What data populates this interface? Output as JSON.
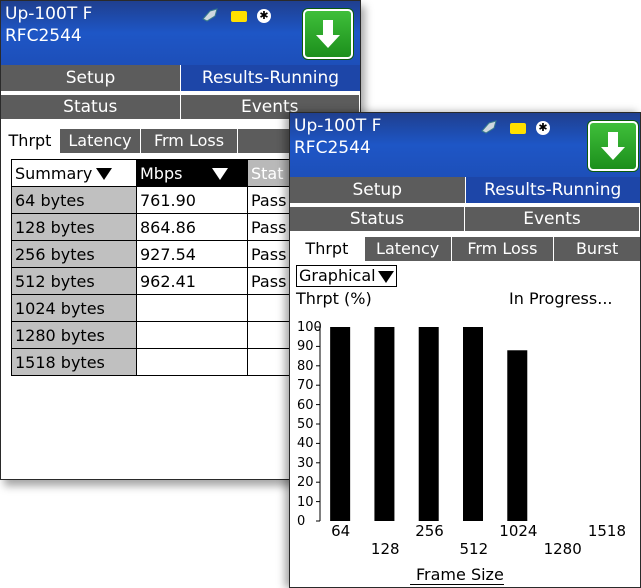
{
  "device": {
    "line1": "Up-100T F",
    "line2": "RFC2544"
  },
  "icons": [
    "usb-icon",
    "folder-icon",
    "bluetooth-icon",
    "download-arrow-icon"
  ],
  "tabs_main": [
    {
      "label": "Setup",
      "active": false
    },
    {
      "label": "Results-Running",
      "active": true
    }
  ],
  "tabs_sub": [
    "Status",
    "Events"
  ],
  "tabs_test": [
    "Thrpt",
    "Latency",
    "Frm Loss",
    "Burst"
  ],
  "summary_panel": {
    "tabs_sub": [
      "Status",
      "Events"
    ],
    "tabs_test": [
      "Thrpt",
      "Latency",
      "Frm Loss"
    ],
    "header": {
      "col1": "Summary",
      "col2": "Mbps",
      "col3": "Stat"
    },
    "rows": [
      {
        "size": "64 bytes",
        "mbps": "761.90",
        "status": "Pass"
      },
      {
        "size": "128 bytes",
        "mbps": "864.86",
        "status": "Pass"
      },
      {
        "size": "256 bytes",
        "mbps": "927.54",
        "status": "Pass"
      },
      {
        "size": "512 bytes",
        "mbps": "962.41",
        "status": "Pass"
      },
      {
        "size": "1024 bytes",
        "mbps": "",
        "status": ""
      },
      {
        "size": "1280 bytes",
        "mbps": "",
        "status": ""
      },
      {
        "size": "1518 bytes",
        "mbps": "",
        "status": ""
      }
    ]
  },
  "graph_panel": {
    "view_select": "Graphical",
    "y_axis_label": "Thrpt (%)",
    "status_text": "In Progress...",
    "x_axis_label": "Frame Size"
  },
  "chart_data": {
    "type": "bar",
    "categories": [
      "64",
      "128",
      "256",
      "512",
      "1024",
      "1280",
      "1518"
    ],
    "values": [
      100,
      100,
      100,
      100,
      88,
      null,
      null
    ],
    "ylabel": "Thrpt (%)",
    "xlabel": "Frame Size",
    "ylim": [
      0,
      100
    ],
    "yticks": [
      "0",
      "10",
      "20",
      "30",
      "40",
      "50",
      "60",
      "70",
      "80",
      "90",
      "100"
    ],
    "bar_color": "#000000"
  },
  "colors": {
    "titlebar": "#1e56c6",
    "active_tab": "#1d46a8",
    "inactive_tab": "#5c5c5c",
    "download_button": "#2aa82a"
  }
}
